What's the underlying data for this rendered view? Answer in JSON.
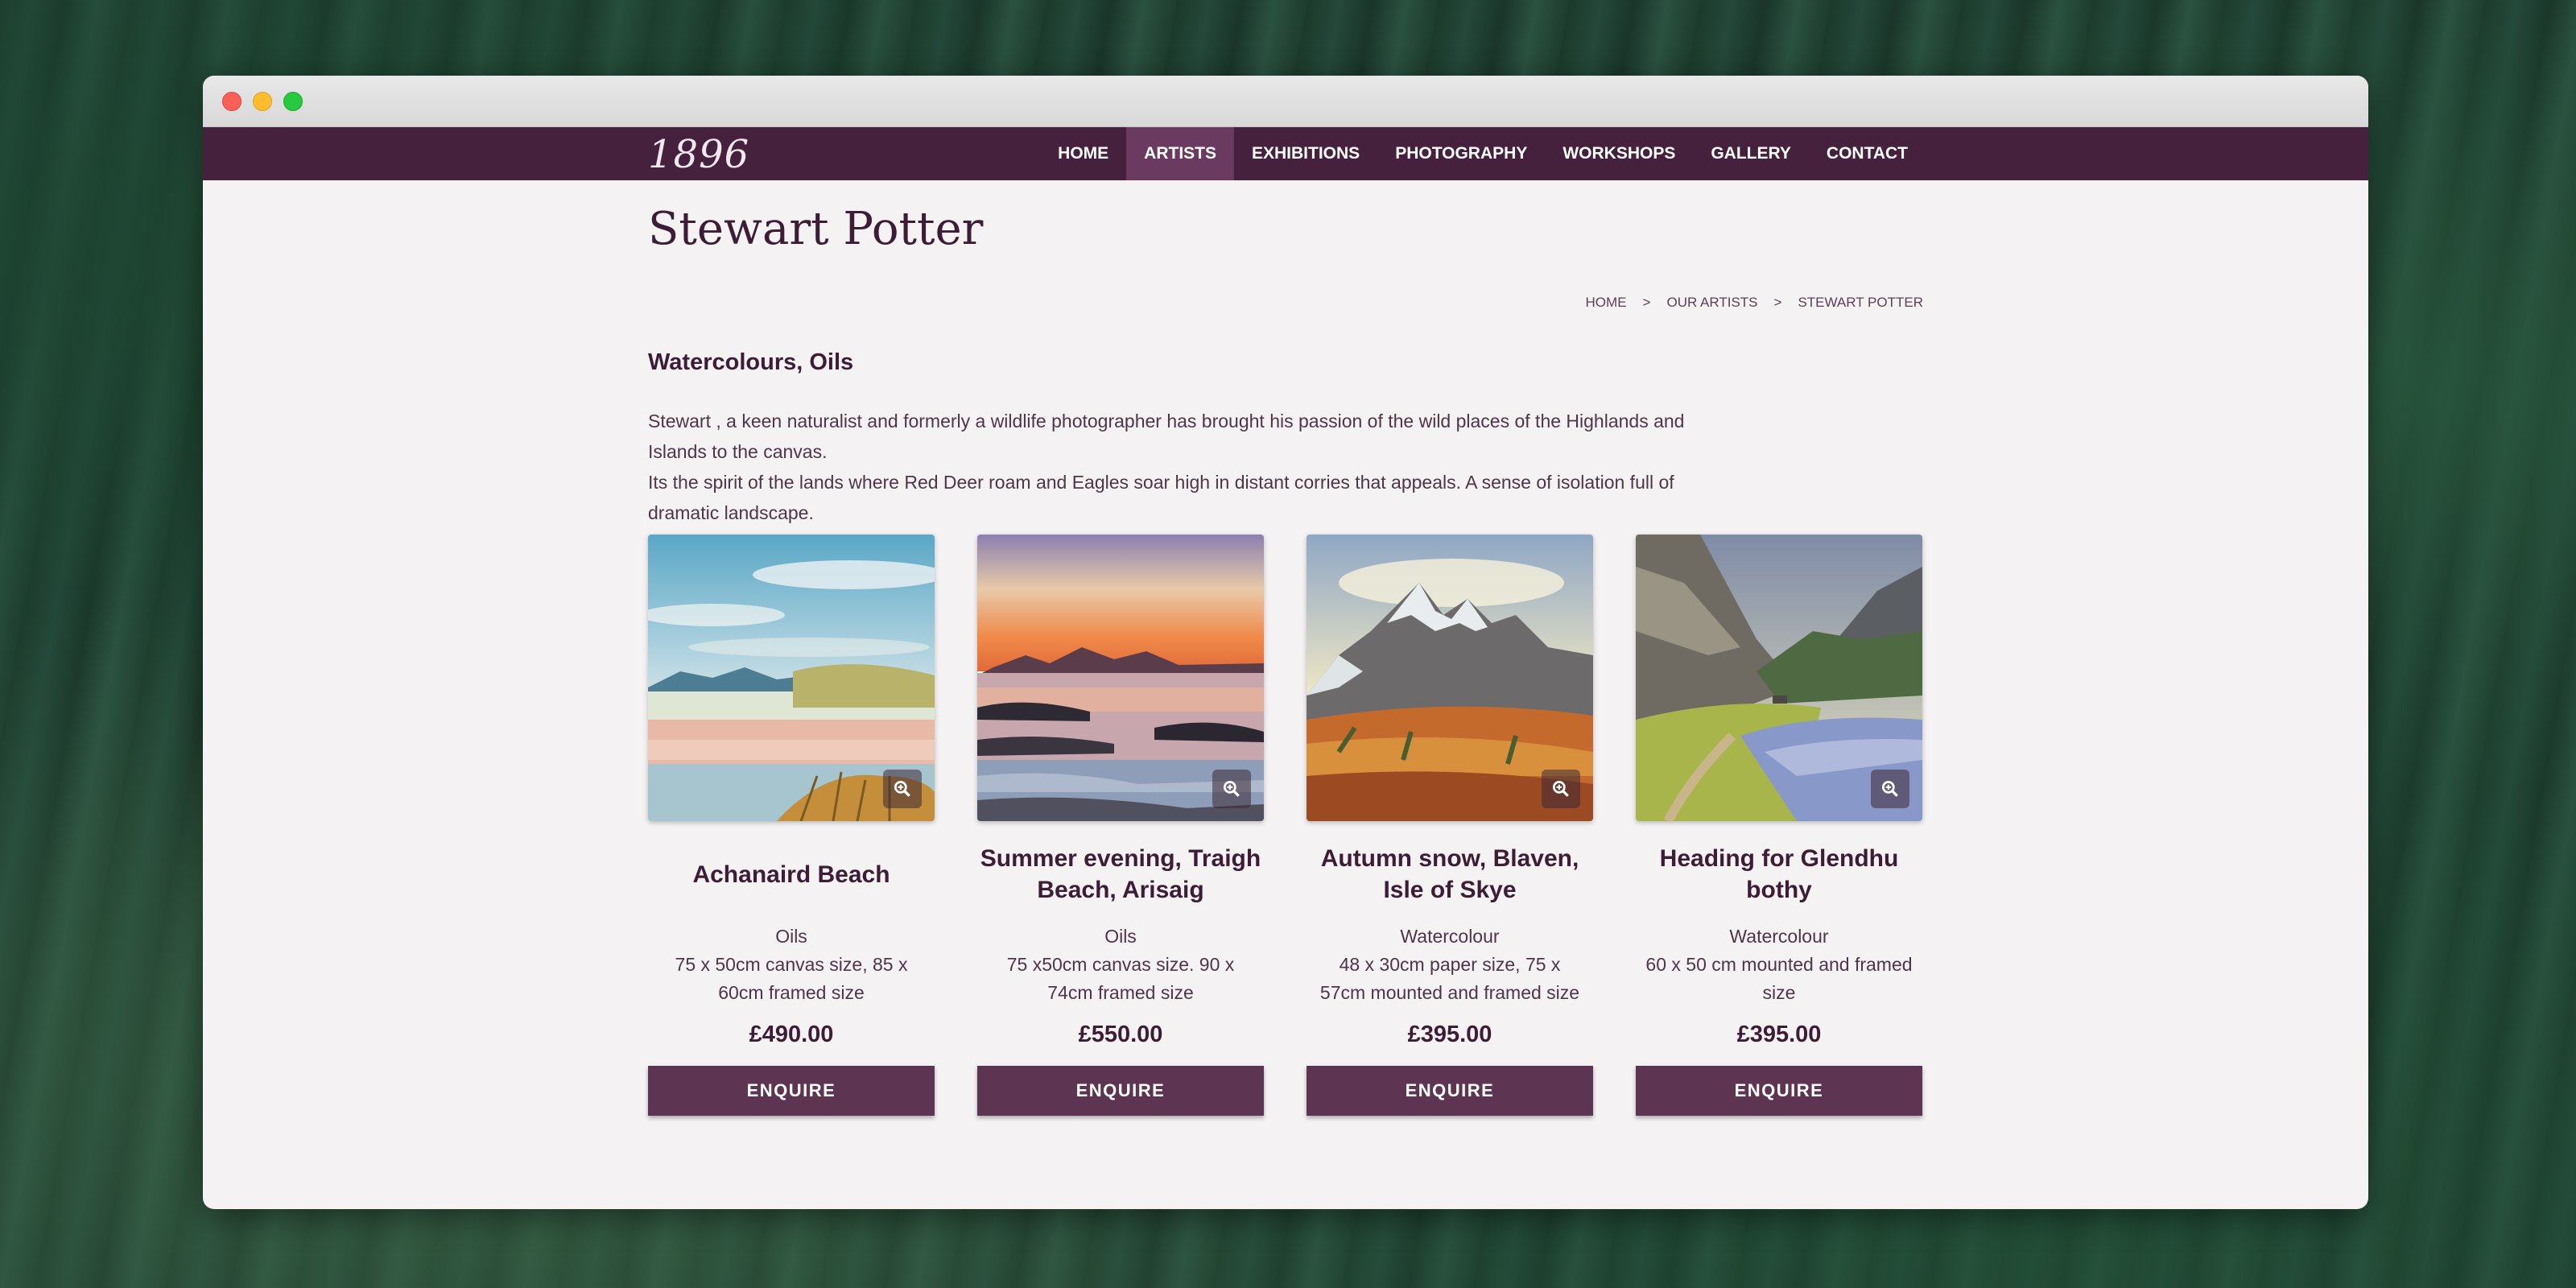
{
  "logo": "1896",
  "nav": [
    {
      "label": "HOME",
      "active": false
    },
    {
      "label": "ARTISTS",
      "active": true
    },
    {
      "label": "EXHIBITIONS",
      "active": false
    },
    {
      "label": "PHOTOGRAPHY",
      "active": false
    },
    {
      "label": "WORKSHOPS",
      "active": false
    },
    {
      "label": "GALLERY",
      "active": false
    },
    {
      "label": "CONTACT",
      "active": false
    }
  ],
  "page": {
    "title": "Stewart Potter",
    "subtitle": "Watercolours, Oils",
    "bio": [
      "Stewart , a keen naturalist and formerly a wildlife photographer has brought his passion of the wild places of the Highlands and Islands to the canvas.",
      "Its the spirit of the lands where Red Deer roam and Eagles soar high in distant corries that appeals. A sense of isolation full of dramatic landscape."
    ]
  },
  "breadcrumb": {
    "home": "HOME",
    "sep": ">",
    "artists": "OUR ARTISTS",
    "current": "STEWART POTTER"
  },
  "products": [
    {
      "title": "Achanaird Beach",
      "medium": "Oils",
      "size": "75 x 50cm canvas size, 85 x 60cm framed size",
      "price": "£490.00",
      "button": "ENQUIRE",
      "icon": "zoom-in-icon"
    },
    {
      "title": "Summer evening, Traigh Beach, Arisaig",
      "medium": "Oils",
      "size": "75 x50cm canvas size. 90 x 74cm framed size",
      "price": "£550.00",
      "button": "ENQUIRE",
      "icon": "zoom-in-icon"
    },
    {
      "title": "Autumn snow, Blaven, Isle of Skye",
      "medium": "Watercolour",
      "size": "48 x 30cm paper size, 75 x 57cm mounted and framed size",
      "price": "£395.00",
      "button": "ENQUIRE",
      "icon": "zoom-in-icon"
    },
    {
      "title": "Heading for Glendhu bothy",
      "medium": "Watercolour",
      "size": "60 x 50 cm mounted and framed size",
      "price": "£395.00",
      "button": "ENQUIRE",
      "icon": "zoom-in-icon"
    }
  ],
  "colors": {
    "nav_bg": "#45213d",
    "nav_active": "#6a3a61",
    "button": "#5d3553",
    "text_dark": "#3d1d36",
    "page_bg": "#f5f2f4"
  }
}
